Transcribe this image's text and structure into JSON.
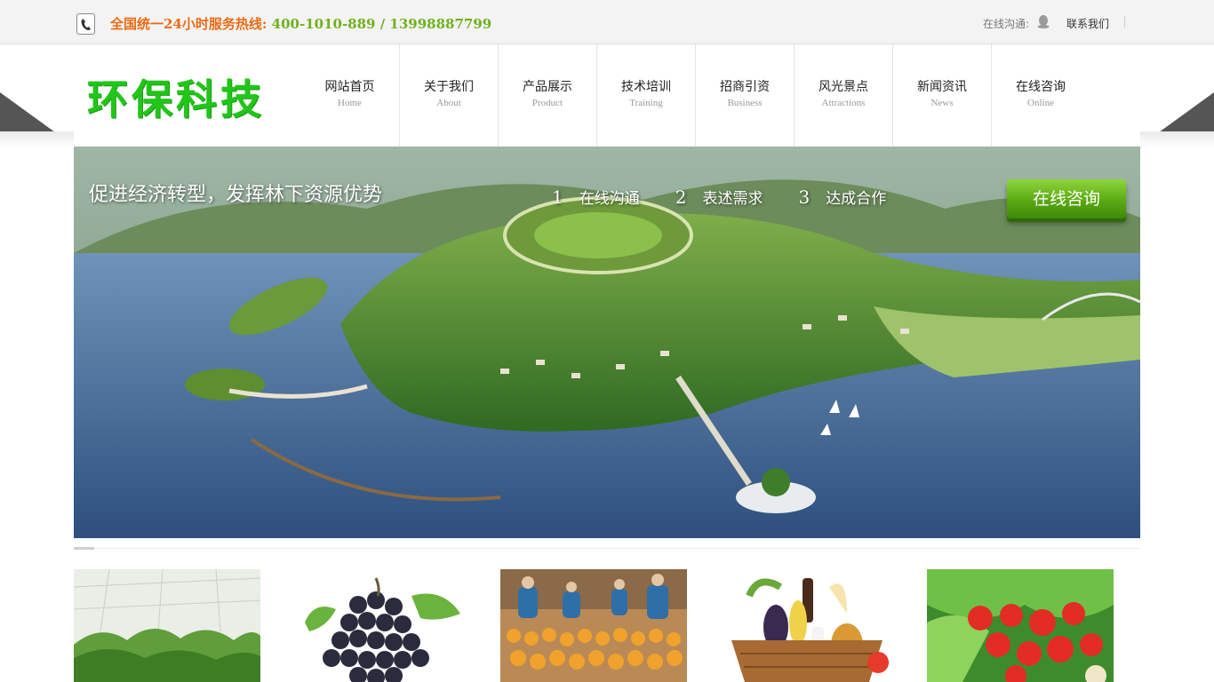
{
  "topbar": {
    "hotline_label": "全国统一24小时服务热线:",
    "hotline_numbers": "400-1010-889  / 13998887799",
    "online_chat": "在线沟通:",
    "contact": "联系我们"
  },
  "logo": {
    "text": "环保科技"
  },
  "nav": [
    {
      "cn": "网站首页",
      "en": "Home"
    },
    {
      "cn": "关于我们",
      "en": "About"
    },
    {
      "cn": "产品展示",
      "en": "Product"
    },
    {
      "cn": "技术培训",
      "en": "Training"
    },
    {
      "cn": "招商引资",
      "en": "Business"
    },
    {
      "cn": "风光景点",
      "en": "Attractions"
    },
    {
      "cn": "新闻资讯",
      "en": "News"
    },
    {
      "cn": "在线咨询",
      "en": "Online"
    }
  ],
  "banner": {
    "slogan": "促进经济转型，发挥林下资源优势",
    "steps": [
      {
        "n": "1",
        "t": "在线沟通"
      },
      {
        "n": "2",
        "t": "表述需求"
      },
      {
        "n": "3",
        "t": "达成合作"
      }
    ],
    "cta": "在线咨询"
  },
  "products": [
    {
      "icon": "greenhouse-seedlings-image"
    },
    {
      "icon": "grapes-image"
    },
    {
      "icon": "fruit-sorting-workers-image"
    },
    {
      "icon": "vegetable-basket-image"
    },
    {
      "icon": "tomato-lettuce-image"
    }
  ],
  "colors": {
    "brand_green": "#22c51a",
    "hotline_orange": "#ec6b12",
    "hotline_green": "#6fb21b",
    "cta_green": "#5aa913"
  }
}
